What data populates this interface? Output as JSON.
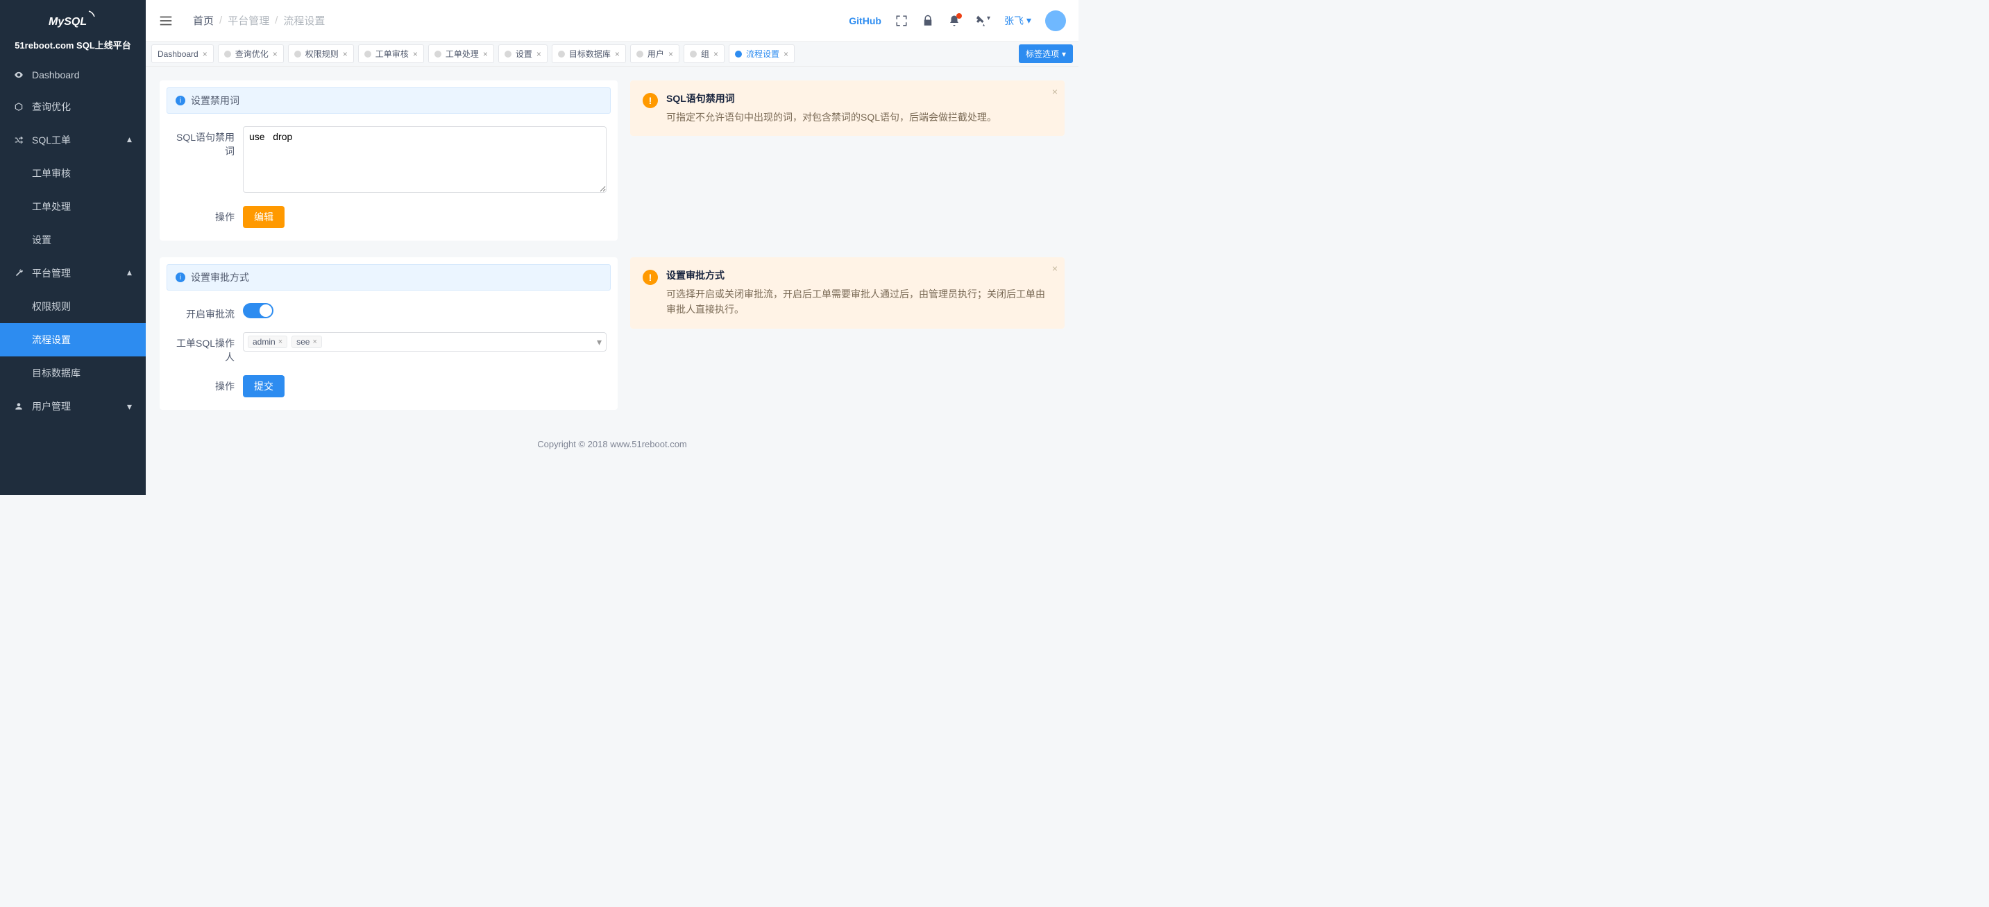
{
  "app": {
    "title": "51reboot.com SQL上线平台",
    "logo_label": "MySQL"
  },
  "sidebar": {
    "items": [
      {
        "name": "dashboard",
        "label": "Dashboard",
        "icon": "eye-icon"
      },
      {
        "name": "query-optimize",
        "label": "查询优化",
        "icon": "cube-icon"
      }
    ],
    "groups": [
      {
        "name": "sql-order",
        "label": "SQL工单",
        "icon": "shuffle-icon",
        "expanded": true,
        "items": [
          {
            "name": "order-review",
            "label": "工单审核"
          },
          {
            "name": "order-process",
            "label": "工单处理"
          },
          {
            "name": "settings",
            "label": "设置"
          }
        ]
      },
      {
        "name": "platform-manage",
        "label": "平台管理",
        "icon": "wrench-icon",
        "expanded": true,
        "items": [
          {
            "name": "permission-rules",
            "label": "权限规则"
          },
          {
            "name": "process-settings",
            "label": "流程设置",
            "active": true
          },
          {
            "name": "target-db",
            "label": "目标数据库"
          }
        ]
      },
      {
        "name": "user-manage",
        "label": "用户管理",
        "icon": "user-icon",
        "expanded": false,
        "items": []
      }
    ]
  },
  "header": {
    "breadcrumb": [
      "首页",
      "平台管理",
      "流程设置"
    ],
    "github_label": "GitHub",
    "user_name": "张飞"
  },
  "tabs": {
    "items": [
      {
        "label": "Dashboard"
      },
      {
        "label": "查询优化"
      },
      {
        "label": "权限规则"
      },
      {
        "label": "工单审核"
      },
      {
        "label": "工单处理"
      },
      {
        "label": "设置"
      },
      {
        "label": "目标数据库"
      },
      {
        "label": "用户"
      },
      {
        "label": "组"
      },
      {
        "label": "流程设置",
        "active": true
      }
    ],
    "action_label": "标签选项"
  },
  "sections": {
    "forbidden": {
      "banner": "设置禁用词",
      "field_label": "SQL语句禁用词",
      "value": "use   drop",
      "action_label": "操作",
      "button_label": "编辑",
      "tip_title": "SQL语句禁用词",
      "tip_desc": "可指定不允许语句中出现的词，对包含禁词的SQL语句，后端会做拦截处理。"
    },
    "approval": {
      "banner": "设置审批方式",
      "switch_label": "开启审批流",
      "switch_on": true,
      "operators_label": "工单SQL操作人",
      "operators": [
        "admin",
        "see"
      ],
      "action_label": "操作",
      "button_label": "提交",
      "tip_title": "设置审批方式",
      "tip_desc": "可选择开启或关闭审批流，开启后工单需要审批人通过后，由管理员执行；关闭后工单由审批人直接执行。"
    }
  },
  "footer": "Copyright © 2018 www.51reboot.com"
}
